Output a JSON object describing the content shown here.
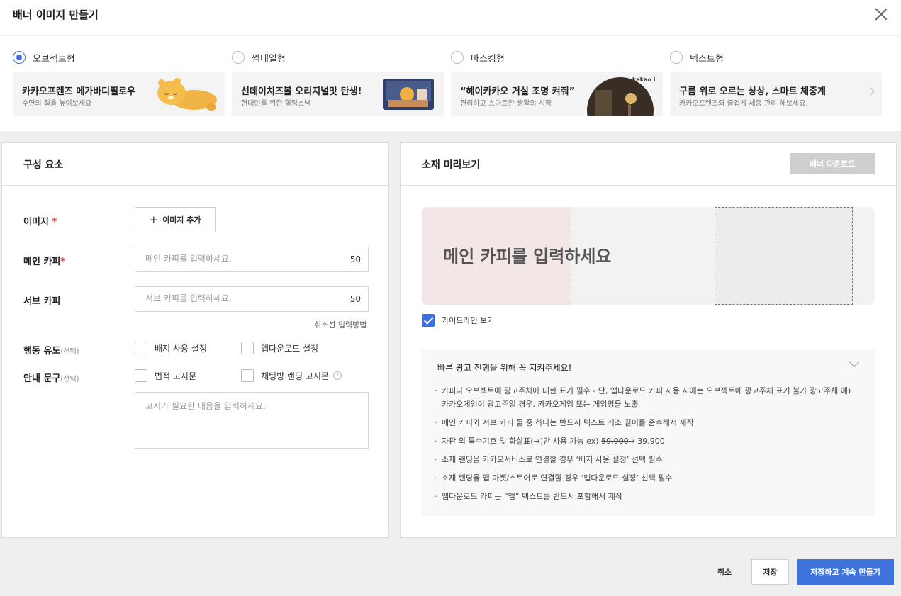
{
  "header": {
    "title": "배너 이미지 만들기"
  },
  "banner_types": [
    {
      "label": "오브젝트형",
      "checked": true,
      "card_title": "카카오프렌즈 메가바디필로우",
      "card_sub": "수면의 질을 높여보세요"
    },
    {
      "label": "썸네일형",
      "checked": false,
      "card_title": "선데이치즈볼 오리지널맛 탄생!",
      "card_sub": "현대인을 위한 힐링스낵"
    },
    {
      "label": "마스킹형",
      "checked": false,
      "card_title": "“헤이카카오 거실 조명 켜줘”",
      "card_sub": "편리하고 스마트한 생활의 시작",
      "card_badge": "kakao i"
    },
    {
      "label": "텍스트형",
      "checked": false,
      "card_title": "구름 위로 오르는 상상, 스마트 체중계",
      "card_sub": "카카오프렌즈와 즐겁게 체중 관리 해보세요."
    }
  ],
  "left_panel": {
    "title": "구성 요소",
    "image_label": "이미지",
    "required_mark": "*",
    "add_image_label": "이미지 추가",
    "main_copy": {
      "label": "메인 카피",
      "placeholder": "메인 카피를 입력하세요.",
      "count": "50",
      "value": ""
    },
    "sub_copy": {
      "label": "서브 카피",
      "placeholder": "서브 카피를 입력하세요.",
      "count": "50",
      "value": ""
    },
    "strike_help": "취소선 입력방법",
    "action_label": "행동 유도",
    "optional": "(선택)",
    "action_options": [
      "배지 사용 설정",
      "앱다운로드 설정"
    ],
    "notice_label": "안내 문구",
    "notice_options": [
      "법적 고지문",
      "채팅방 랜딩 고지문"
    ],
    "help_glyph": "?",
    "notice_placeholder": "고지가 필요한 내용을 입력하세요."
  },
  "right_panel": {
    "title": "소재 미리보기",
    "download_label": "배너 다운로드",
    "preview_copy": "메인 카피를 입력하세요",
    "guide_toggle_label": "가이드라인 보기",
    "guide_toggle_checked": true,
    "guide_title": "빠른 광고 진행을 위해 꼭 지켜주세요!",
    "guide_items": [
      "카피나 오브젝트에 광고주체에 대한 표기 필수 - 단, 앱다운로드 카피 사용 시에는 오브젝트에 광고주체 표기 불가 광고주체 예) 카카오게임이 광고주일 경우, 카카오게임 또는 게임명을 노출",
      "메인 카피와 서브 카피 둘 중 하나는 반드시 텍스트 최소 길이를 준수해서 제작",
      "소재 랜딩을 카카오서비스로 연결할 경우 ‘배지 사용 설정’ 선택 필수",
      "소재 랜딩을 앱 마켓/스토어로 연결할 경우 ‘앱다운로드 설정’ 선택 필수",
      "앱다운로드 카피는 “앱” 텍스트를 반드시 포함해서 제작"
    ],
    "guide_special": {
      "prefix": "자판 외 특수기호 및 화살표(→)만 사용 가능 ex) ",
      "strike": "59,900",
      "suffix": "→ 39,900"
    }
  },
  "footer": {
    "cancel": "취소",
    "save": "저장",
    "save_continue": "저장하고 계속 만들기"
  },
  "colors": {
    "accent": "#3e73de",
    "required": "#e23c3c",
    "preview_safe": "#f3e6e6"
  }
}
